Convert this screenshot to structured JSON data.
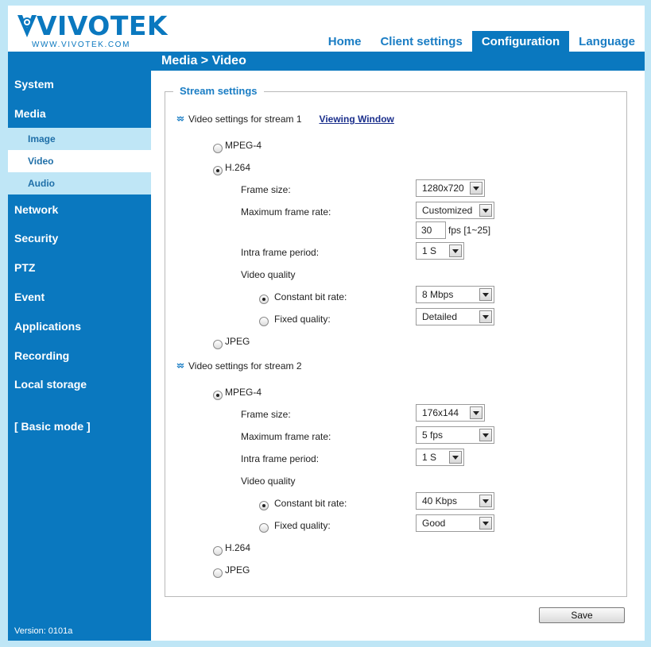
{
  "brand": {
    "name": "VIVOTEK",
    "url": "WWW.VIVOTEK.COM",
    "color": "#0a78bf"
  },
  "topnav": [
    "Home",
    "Client settings",
    "Configuration",
    "Language"
  ],
  "topnav_active": "Configuration",
  "breadcrumb": "Media  > Video",
  "sidebar": {
    "items": {
      "system": "System",
      "media": "Media",
      "image": "Image",
      "video": "Video",
      "audio": "Audio",
      "network": "Network",
      "security": "Security",
      "ptz": "PTZ",
      "event": "Event",
      "applications": "Applications",
      "recording": "Recording",
      "local_storage": "Local storage",
      "basic_mode": "[ Basic mode ]"
    },
    "active": "Video",
    "version": "Version: 0101a"
  },
  "stream_settings": {
    "legend": "Stream settings",
    "stream1": {
      "title": "Video settings for stream 1",
      "viewing_window": "Viewing Window",
      "codec_mpeg4": "MPEG-4",
      "codec_h264": "H.264",
      "codec_jpeg": "JPEG",
      "selected_codec": "H.264",
      "frame_size_label": "Frame size:",
      "frame_size": "1280x720",
      "max_frame_rate_label": "Maximum frame rate:",
      "max_frame_rate": "Customized",
      "fps_value": "30",
      "fps_hint": "fps [1~25]",
      "intra_label": "Intra frame period:",
      "intra": "1 S",
      "video_quality_label": "Video quality",
      "cbr_label": "Constant bit rate:",
      "cbr": "8 Mbps",
      "fixed_label": "Fixed quality:",
      "fixed": "Detailed",
      "selected_quality": "Constant bit rate"
    },
    "stream2": {
      "title": "Video settings for stream 2",
      "codec_mpeg4": "MPEG-4",
      "codec_h264": "H.264",
      "codec_jpeg": "JPEG",
      "selected_codec": "MPEG-4",
      "frame_size_label": "Frame size:",
      "frame_size": "176x144",
      "max_frame_rate_label": "Maximum frame rate:",
      "max_frame_rate": "5 fps",
      "intra_label": "Intra frame period:",
      "intra": "1 S",
      "video_quality_label": "Video quality",
      "cbr_label": "Constant bit rate:",
      "cbr": "40 Kbps",
      "fixed_label": "Fixed quality:",
      "fixed": "Good",
      "selected_quality": "Constant bit rate"
    }
  },
  "save_label": "Save"
}
